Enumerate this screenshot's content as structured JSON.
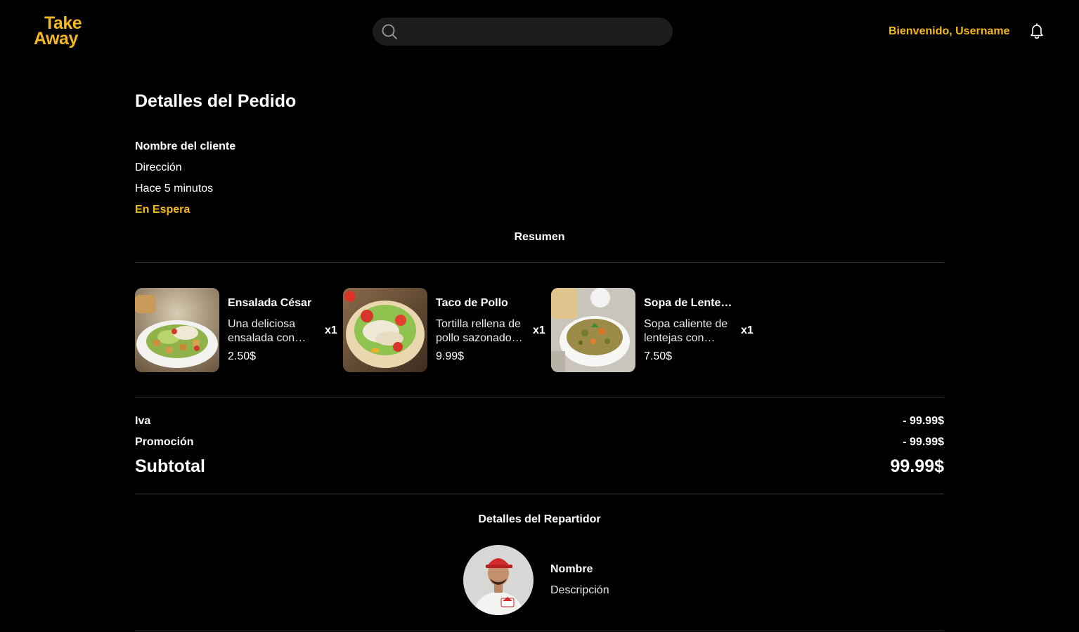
{
  "header": {
    "logo_line1": "Take",
    "logo_line2": "Away",
    "search_placeholder": "",
    "welcome": "Bienvenido, Username",
    "accent_color": "#f5b91b"
  },
  "order": {
    "title": "Detalles del Pedido",
    "client_name": "Nombre del cliente",
    "address": "Dirección",
    "time": "Hace 5 minutos",
    "status": "En Espera"
  },
  "summary": {
    "title": "Resumen",
    "items": [
      {
        "name": "Ensalada César",
        "description": "Una deliciosa ensalada con lechuga, crutones y aderezo",
        "price": "2.50$",
        "qty": "x1",
        "image": "caesar-salad"
      },
      {
        "name": "Taco de Pollo",
        "description": "Tortilla rellena de pollo sazonado con vegetales",
        "price": "9.99$",
        "qty": "x1",
        "image": "chicken-taco"
      },
      {
        "name": "Sopa de Lentejas",
        "description": "Sopa caliente de lentejas con verduras",
        "price": "7.50$",
        "qty": "x1",
        "image": "lentil-soup"
      }
    ]
  },
  "totals": {
    "iva_label": "Iva",
    "iva_value": "- 99.99$",
    "promo_label": "Promoción",
    "promo_value": "- 99.99$",
    "subtotal_label": "Subtotal",
    "subtotal_value": "99.99$"
  },
  "driver": {
    "title": "Detalles del Repartidor",
    "name": "Nombre",
    "description": "Descripción"
  }
}
